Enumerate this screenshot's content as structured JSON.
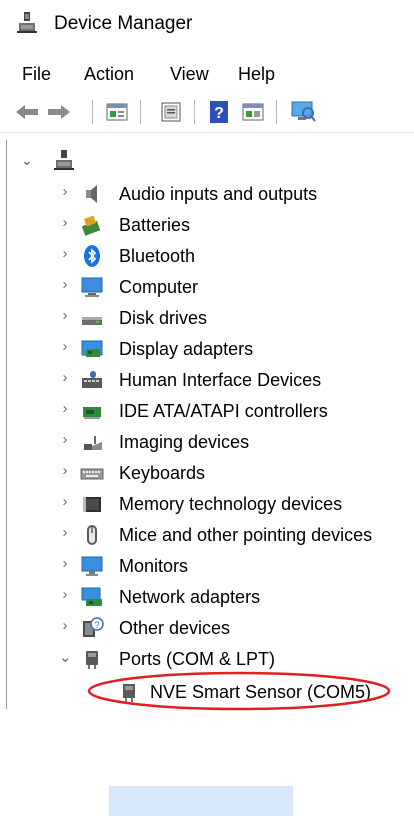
{
  "window": {
    "title": "Device Manager"
  },
  "menu": {
    "items": [
      "File",
      "Action",
      "View",
      "Help"
    ]
  },
  "toolbar": {
    "buttons": [
      "back-icon",
      "forward-icon",
      "properties-icon",
      "update-driver-icon",
      "help-icon",
      "show-hidden-icon",
      "scan-hardware-icon"
    ]
  },
  "tree": {
    "categories": [
      "Audio inputs and outputs",
      "Batteries",
      "Bluetooth",
      "Computer",
      "Disk drives",
      "Display adapters",
      "Human Interface Devices",
      "IDE ATA/ATAPI controllers",
      "Imaging devices",
      "Keyboards",
      "Memory technology devices",
      "Mice and other pointing devices",
      "Monitors",
      "Network adapters",
      "Other devices",
      "Ports (COM & LPT)"
    ],
    "expanded_child": "NVE Smart Sensor (COM5)"
  },
  "colors": {
    "selection": "#d9e9fb",
    "annotation": "#e0201e",
    "accent": "#1a73d9"
  }
}
